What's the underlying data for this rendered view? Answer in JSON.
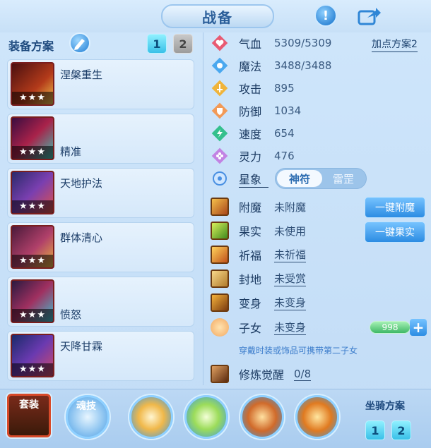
{
  "header": {
    "title": "战备"
  },
  "equipment": {
    "label": "装备方案",
    "schemes": [
      "1",
      "2"
    ],
    "skills": [
      {
        "name": "涅槃重生",
        "stars": "★★★",
        "name_pos": "top"
      },
      {
        "name": "精准",
        "stars": "★★★",
        "name_pos": "bottom"
      },
      {
        "name": "天地护法",
        "stars": "★★★",
        "name_pos": "top"
      },
      {
        "name": "群体清心",
        "stars": "★★★",
        "name_pos": "top"
      },
      {
        "name": "愤怒",
        "stars": "★★★",
        "name_pos": "bottom"
      },
      {
        "name": "天降甘霖",
        "stars": "★★★",
        "name_pos": "top"
      }
    ]
  },
  "attributes": {
    "plan_link": "加点方案2",
    "rows": [
      {
        "label": "气血",
        "value": "5309/5309",
        "color": "#e85a72"
      },
      {
        "label": "魔法",
        "value": "3488/3488",
        "color": "#4aa8ef"
      },
      {
        "label": "攻击",
        "value": "895",
        "color": "#f0b43a"
      },
      {
        "label": "防御",
        "value": "1034",
        "color": "#f29a57"
      },
      {
        "label": "速度",
        "value": "654",
        "color": "#34c08d"
      },
      {
        "label": "灵力",
        "value": "476",
        "color": "#c283e3"
      }
    ],
    "star_label": "星象",
    "star_options": [
      "神符",
      "雷罡"
    ]
  },
  "enhance": {
    "rows": [
      {
        "label": "附魔",
        "value": "未附魔",
        "underline": false
      },
      {
        "label": "果实",
        "value": "未使用",
        "underline": false
      },
      {
        "label": "祈福",
        "value": "未祈福",
        "underline": true
      },
      {
        "label": "封地",
        "value": "未受赏",
        "underline": true
      },
      {
        "label": "变身",
        "value": "未变身",
        "underline": true
      },
      {
        "label": "子女",
        "value": "未变身",
        "underline": true
      }
    ],
    "btn_enchant": "一键附魔",
    "btn_fruit": "一键果实",
    "child_count": "998",
    "plus": "+",
    "hint": "穿戴时装或饰品可携带第二子女",
    "awaken_label": "修炼觉醒",
    "awaken_value": "0/8"
  },
  "bottom": {
    "set_label": "套装",
    "soul_label": "魂技",
    "mount_label": "坐骑方案",
    "mount_schemes": [
      "1",
      "2"
    ]
  }
}
